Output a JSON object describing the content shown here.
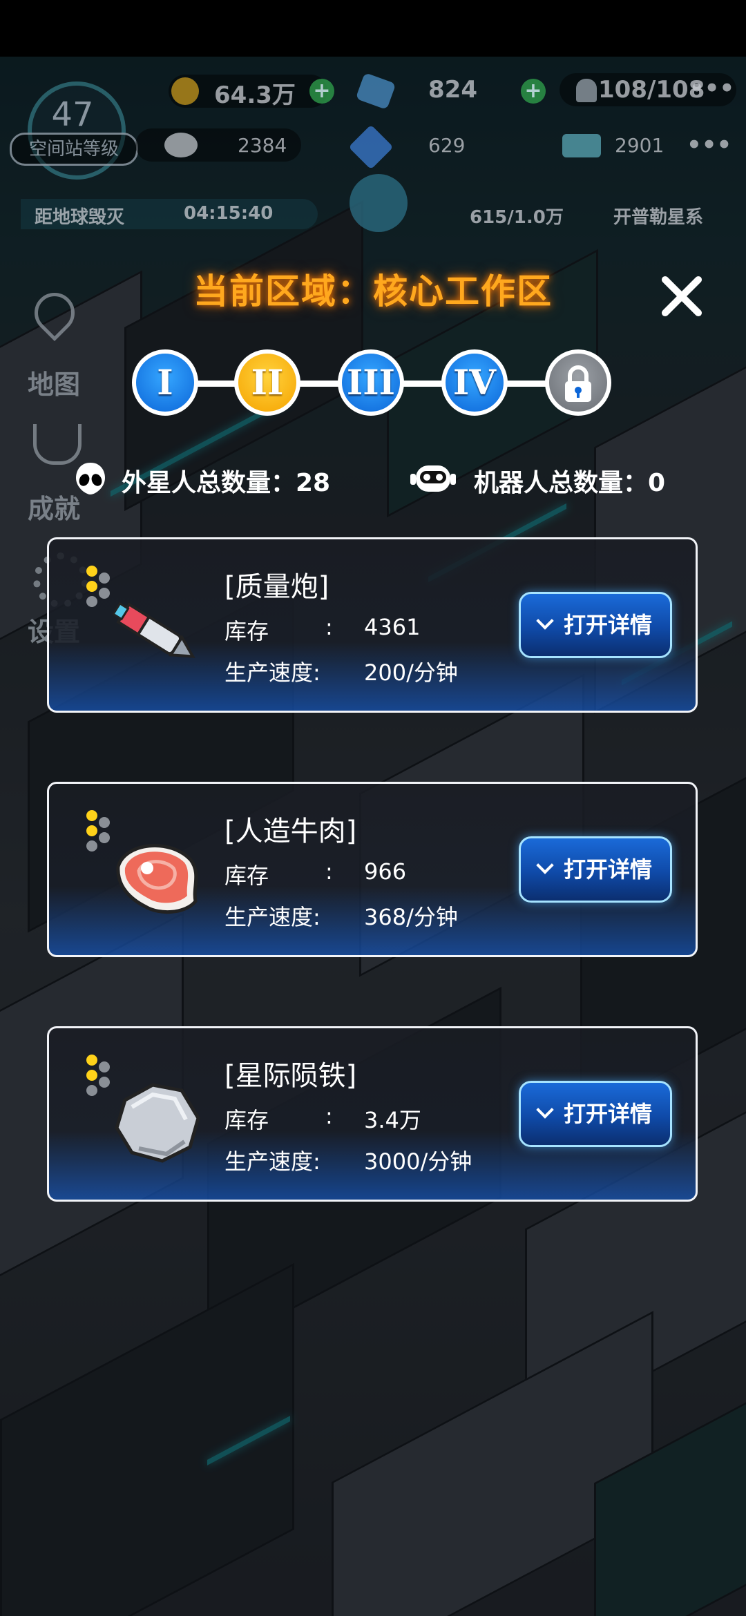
{
  "hud": {
    "gold": "64.3万",
    "gems": "824",
    "population": "108/108",
    "res1": "2384",
    "res2": "629",
    "res3": "2901",
    "station_level": "47",
    "station_level_label": "空间站等级",
    "countdown_label": "距地球毁灭",
    "countdown": "04:15:40",
    "energy": "615/1.0万",
    "destination": "开普勒星系",
    "more": "•••"
  },
  "side_menu": {
    "map": "地图",
    "achievement": "成就",
    "settings": "设置"
  },
  "panel": {
    "title": "当前区域：核心工作区",
    "close": "✕",
    "stages": [
      "I",
      "II",
      "III",
      "IV"
    ],
    "selected_stage": "II",
    "alien_count_label": "外星人总数量：28",
    "robot_count_label": "机器人总数量：0"
  },
  "items": [
    {
      "name": "[质量炮]",
      "stock_label": "库存",
      "stock": "4361",
      "speed_label": "生产速度:",
      "speed": "200/分钟",
      "button": "打开详情",
      "icon": "missile-icon"
    },
    {
      "name": "[人造牛肉]",
      "stock_label": "库存",
      "stock": "966",
      "speed_label": "生产速度:",
      "speed": "368/分钟",
      "button": "打开详情",
      "icon": "steak-icon"
    },
    {
      "name": "[星际陨铁]",
      "stock_label": "库存",
      "stock": "3.4万",
      "speed_label": "生产速度:",
      "speed": "3000/分钟",
      "button": "打开详情",
      "icon": "meteorite-icon"
    }
  ],
  "colors": {
    "title": "#ffa81e",
    "stage_blue": "#0c66d8",
    "stage_selected": "#f5a300",
    "button": "#1a6ad8"
  }
}
